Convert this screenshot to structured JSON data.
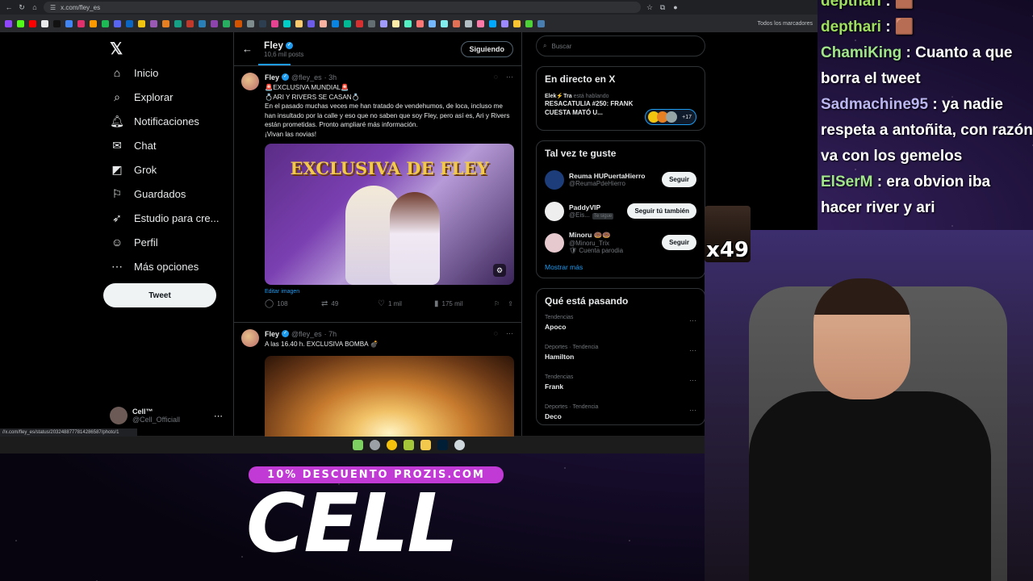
{
  "browser": {
    "url": "x.com/fley_es",
    "bookmark_folder": "Todos los marcadores",
    "status_url": "//x.com/fley_es/status/2032488777814286587/photo/1"
  },
  "nav": {
    "items": [
      {
        "label": "Inicio",
        "icon": "home-icon"
      },
      {
        "label": "Explorar",
        "icon": "search-icon"
      },
      {
        "label": "Notificaciones",
        "icon": "bell-icon"
      },
      {
        "label": "Chat",
        "icon": "mail-icon"
      },
      {
        "label": "Grok",
        "icon": "grok-icon"
      },
      {
        "label": "Guardados",
        "icon": "bookmark-icon"
      },
      {
        "label": "Estudio para cre...",
        "icon": "rocket-icon"
      },
      {
        "label": "Perfil",
        "icon": "person-icon"
      },
      {
        "label": "Más opciones",
        "icon": "more-icon"
      }
    ],
    "tweet_button": "Tweet",
    "account": {
      "name": "Cell™",
      "handle": "@Cell_Officiall"
    }
  },
  "profile_header": {
    "name": "Fley",
    "posts": "10,6 mil posts",
    "follow_state": "Siguiendo"
  },
  "tweets": [
    {
      "name": "Fley",
      "handle": "@fley_es",
      "time": "· 3h",
      "lines": [
        "🚨EXCLUSIVA MUNDIAL🚨",
        "💍ARI Y RIVERS SE CASAN💍",
        "En el pasado muchas veces me han tratado de vendehumos, de loca, incluso me han insultado por la calle y eso que no saben que soy Fley, pero así es, Ari y Rivers están prometidas. Pronto ampliaré más información.",
        "¡Vivan las novias!"
      ],
      "image_headline": "EXCLUSIVA DE FLEY",
      "edit_image": "Editar imagen",
      "replies": "108",
      "retweets": "49",
      "likes": "1 mil",
      "views": "175 mil"
    },
    {
      "name": "Fley",
      "handle": "@fley_es",
      "time": "· 7h",
      "text": "A las 16.40 h. EXCLUSIVA BOMBA 💣"
    }
  ],
  "sidebar": {
    "search_placeholder": "Buscar",
    "live": {
      "title": "En directo en X",
      "host": "Elek⚡Tra",
      "host_suffix": " está hablando",
      "space_title": "RESACATULIA #250: FRANK CUESTA MATÓ U...",
      "listeners": "+17"
    },
    "suggestions": {
      "title": "Tal vez te guste",
      "items": [
        {
          "name": "Reuma HUPuertaHierro",
          "handle": "@ReumaPdeHierro",
          "button": "Seguir",
          "note": ""
        },
        {
          "name": "PaddyVIP",
          "handle": "@Eis...",
          "button": "Seguir tú también",
          "note": "Te sigue"
        },
        {
          "name": "Minoru 🍩🍩",
          "handle": "@Minoru_Trix",
          "button": "Seguir",
          "note": "🛡 Cuenta parodia"
        }
      ],
      "more": "Mostrar más"
    },
    "trends": {
      "title": "Qué está pasando",
      "items": [
        {
          "category": "Tendencias",
          "name": "Apoco"
        },
        {
          "category": "Deportes · Tendencia",
          "name": "Hamilton"
        },
        {
          "category": "Tendencias",
          "name": "Frank"
        },
        {
          "category": "Deportes · Tendencia",
          "name": "Deco"
        }
      ]
    }
  },
  "chat": {
    "lines": [
      {
        "user": "depthari",
        "text": " : 🟫"
      },
      {
        "user": "depthari",
        "text": " : 🟫"
      },
      {
        "user": "ChamiKing",
        "text": " : Cuanto a que borra el tweet"
      },
      {
        "user": "Sadmachine95",
        "text": " : ya nadie respeta a antoñita, con razón va con los gemelos"
      },
      {
        "user": "ElSerM",
        "text": " : era obvion iba hacer river y ari"
      }
    ],
    "emote_count": "x49"
  },
  "overlay": {
    "promo": "10% DESCUENTO PROZIS.COM",
    "streamer": "CELL"
  },
  "colors": {
    "accent": "#1d9bf0",
    "promo": "#c13ad6"
  }
}
